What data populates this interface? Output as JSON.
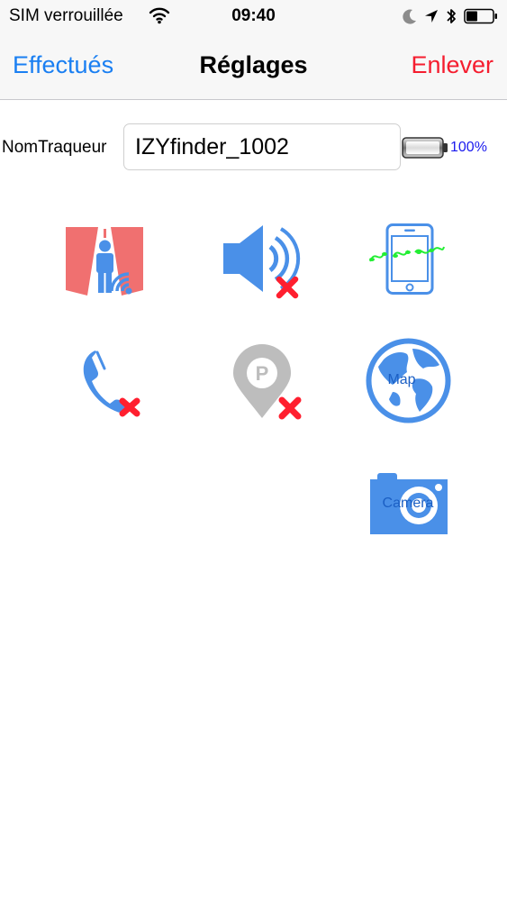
{
  "status_bar": {
    "carrier": "SIM verrouillée",
    "time": "09:40",
    "icons": [
      "wifi-icon",
      "moon-icon",
      "location-arrow-icon",
      "bluetooth-icon",
      "battery-icon"
    ]
  },
  "nav": {
    "left_button": "Effectués",
    "title": "Réglages",
    "right_button": "Enlever"
  },
  "tracker": {
    "label": "NomTraqueur",
    "name_value": "IZYfinder_1002",
    "battery_percent": "100%"
  },
  "icons": {
    "map_label": "Map",
    "camera_label": "Camera",
    "names": [
      "perimeter-alarm-icon",
      "sound-muted-icon",
      "phone-ringtone-icon",
      "call-disabled-icon",
      "parking-disabled-icon",
      "map-icon",
      "camera-icon"
    ]
  },
  "colors": {
    "ios_blue": "#1a7ff2",
    "destructive_red": "#f51d2f",
    "icon_blue": "#4a90e8",
    "icon_red": "#ff1f2f",
    "zone_red": "#f07070",
    "music_green": "#22ee33",
    "pin_gray": "#bdbdbd",
    "battery_text": "#1a1aee"
  }
}
